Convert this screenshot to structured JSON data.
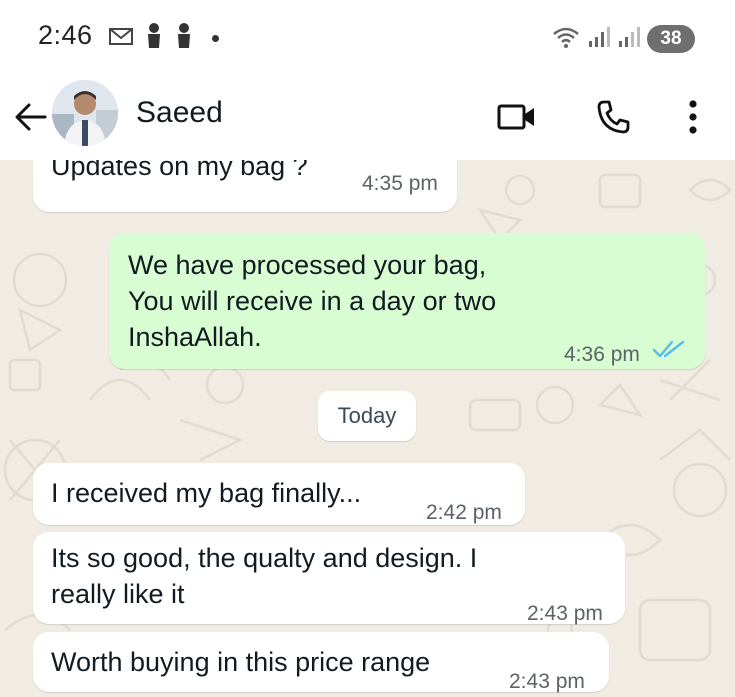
{
  "status_bar": {
    "time": "2:46",
    "battery": "38"
  },
  "header": {
    "contact_name": "Saeed"
  },
  "chat": {
    "date_divider": "Today",
    "messages": [
      {
        "direction": "incoming",
        "text": "Updates on my bag ?",
        "time": "4:35 pm"
      },
      {
        "direction": "outgoing",
        "text": "We have processed your bag,\nYou will receive in a day or two\nInshaAllah.",
        "time": "4:36 pm",
        "status": "read"
      },
      {
        "direction": "incoming",
        "text": "I received my bag finally...",
        "time": "2:42 pm"
      },
      {
        "direction": "incoming",
        "text": "Its so good, the qualty and design. I\nreally like it",
        "time": "2:43 pm"
      },
      {
        "direction": "incoming",
        "text": "Worth buying in this price range",
        "time": "2:43 pm"
      }
    ]
  },
  "colors": {
    "incoming_bubble": "#ffffff",
    "outgoing_bubble": "#d9fdd3",
    "chat_background": "#f0ebe3",
    "read_ticks": "#53bdeb"
  },
  "icons": [
    "gmail-icon",
    "notification-icon",
    "notification-icon",
    "dot-icon",
    "wifi-icon",
    "signal-icon",
    "signal-icon",
    "back-arrow-icon",
    "video-call-icon",
    "phone-icon",
    "more-options-icon",
    "double-check-icon"
  ]
}
